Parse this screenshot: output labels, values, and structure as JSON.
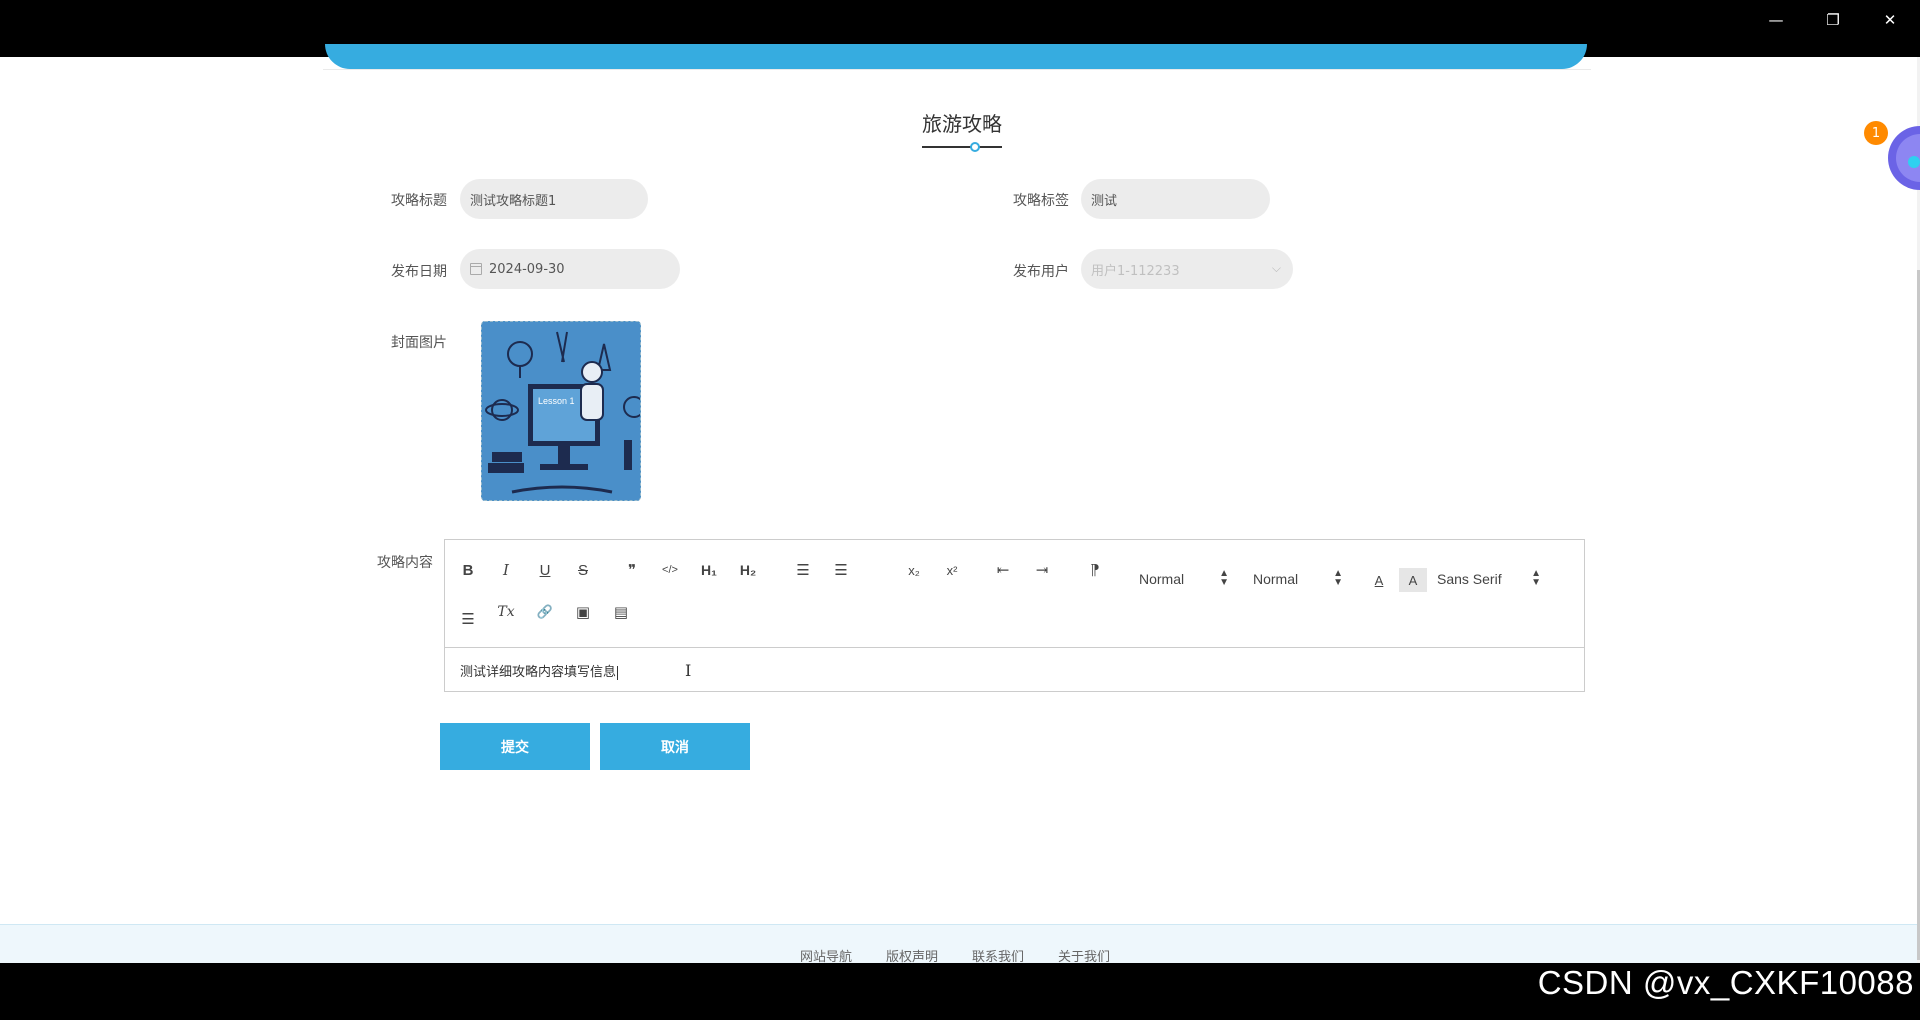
{
  "window": {
    "minimize_glyph": "—",
    "maximize_glyph": "❐",
    "close_glyph": "✕"
  },
  "page": {
    "title": "旅游攻略"
  },
  "form": {
    "title_label": "攻略标题",
    "title_value": "测试攻略标题1",
    "tag_label": "攻略标签",
    "tag_value": "测试",
    "date_label": "发布日期",
    "date_value": "2024-09-30",
    "user_label": "发布用户",
    "user_placeholder": "用户1-112233",
    "cover_label": "封面图片",
    "cover_text": "Lesson 1",
    "content_label": "攻略内容",
    "content_value": "测试详细攻略内容填写信息"
  },
  "editor": {
    "toolbar": {
      "bold": "B",
      "italic": "I",
      "underline": "U",
      "strike": "S",
      "blockquote": "❞",
      "code": "</>",
      "h1": "H₁",
      "h2": "H₂",
      "ordered_list": "☰",
      "bullet_list": "☰",
      "subscript": "x₂",
      "superscript": "x²",
      "outdent": "⇤",
      "indent": "⇥",
      "direction": "⁋",
      "size_picker": "Normal",
      "header_picker": "Normal",
      "color": "A",
      "background": "A",
      "font_picker": "Sans Serif",
      "align": "☰",
      "clean": "Tx",
      "link": "🔗",
      "image": "▣",
      "video": "▤"
    }
  },
  "buttons": {
    "submit": "提交",
    "cancel": "取消"
  },
  "footer": {
    "links": [
      "网站导航",
      "版权声明",
      "联系我们",
      "关于我们"
    ]
  },
  "watermark": "CSDN @vx_CXKF10088",
  "assistant": {
    "badge": "1"
  },
  "colors": {
    "accent": "#36ace0",
    "titlebar": "#000000",
    "field_bg": "#ececec",
    "badge": "#ff8a00"
  }
}
